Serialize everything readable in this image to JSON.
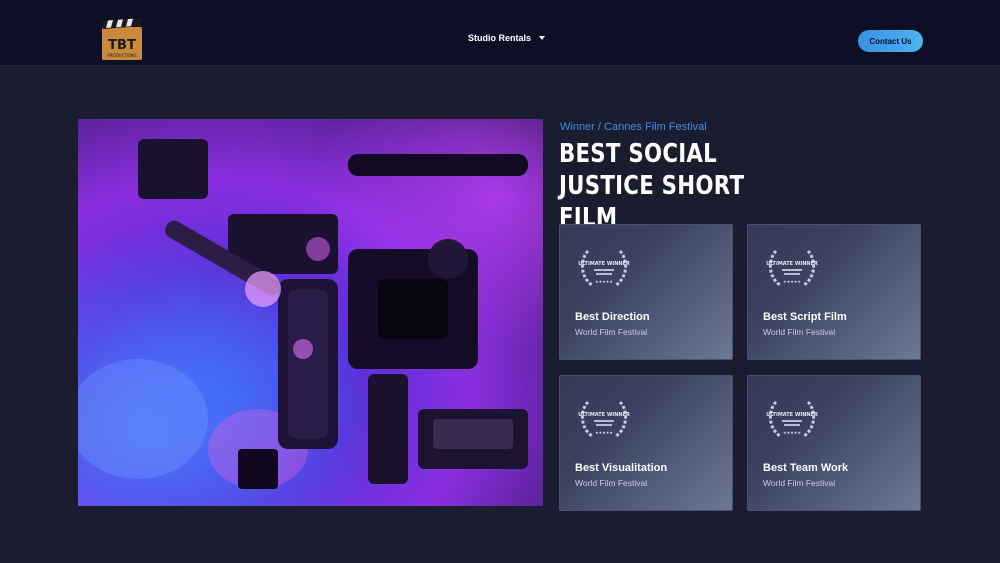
{
  "header": {
    "logo_text": "TBT",
    "logo_subtext": "PRODUCTIONS",
    "nav_label": "Studio Rentals",
    "contact_label": "Contact Us"
  },
  "hero": {
    "subtitle": "Winner / Cannes Film Festival",
    "headline": "BEST SOCIAL JUSTICE SHORT FILM"
  },
  "awards": [
    {
      "title": "Best Direction",
      "festival": "World Film Festival",
      "badge_text": "ULTIMATE WINNER"
    },
    {
      "title": "Best Script Film",
      "festival": "World Film Festival",
      "badge_text": "ULTIMATE WINNER"
    },
    {
      "title": "Best Visualitation",
      "festival": "World Film Festival",
      "badge_text": "ULTIMATE WINNER"
    },
    {
      "title": "Best Team Work",
      "festival": "World Film Festival",
      "badge_text": "ULTIMATE WINNER"
    }
  ],
  "colors": {
    "background": "#1b1c30",
    "header": "#0e0f26",
    "accent": "#3d8fe8",
    "button": "#4cb4f0"
  },
  "icons": {
    "logo": "clapperboard-logo-icon",
    "nav_caret": "chevron-down-icon",
    "award": "laurel-wreath-icon"
  }
}
